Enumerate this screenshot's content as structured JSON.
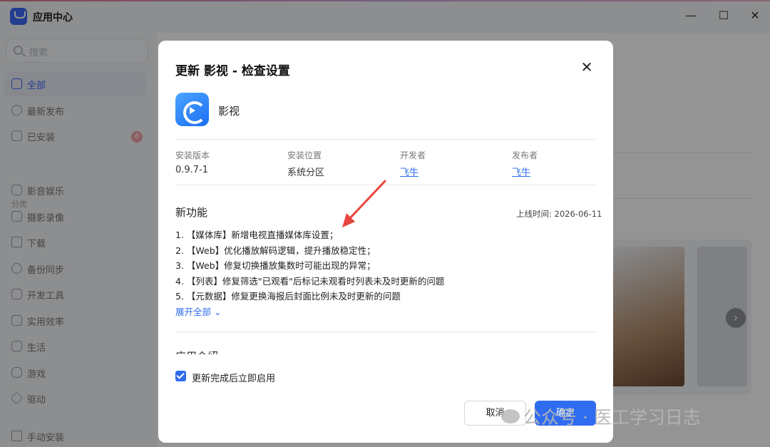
{
  "window": {
    "title": "应用中心",
    "minimize": "—",
    "maximize": "☐",
    "close": "✕"
  },
  "sidebar": {
    "search_placeholder": "搜索",
    "items": [
      {
        "label": "全部",
        "active": true
      },
      {
        "label": "最新发布"
      },
      {
        "label": "已安装",
        "badge": "6"
      }
    ],
    "category_title": "分类",
    "categories": [
      "影音娱乐",
      "摄影录像",
      "下载",
      "备份同步",
      "开发工具",
      "实用效率",
      "生活",
      "游戏",
      "驱动"
    ],
    "manual_install": "手动安装"
  },
  "background": {
    "carousel_next": "›"
  },
  "modal": {
    "title": "更新 影视 - 检查设置",
    "close": "✕",
    "app_name": "影视",
    "info": [
      {
        "label": "安装版本",
        "value": "0.9.7-1"
      },
      {
        "label": "安装位置",
        "value": "系统分区"
      },
      {
        "label": "开发者",
        "value": "飞牛"
      },
      {
        "label": "发布者",
        "value": "飞牛"
      }
    ],
    "new_features_title": "新功能",
    "release_date": "上线时间: 2026-06-11",
    "features": [
      "1. 【媒体库】新增电视直播媒体库设置；",
      "2. 【Web】优化播放解码逻辑，提升播放稳定性；",
      "3. 【Web】修复切换播放集数时可能出现的异常；",
      "4. 【列表】修复筛选\"已观看\"后标记未观看时列表未及时更新的问题",
      "5. 【元数据】修复更换海报后封面比例未及时更新的问题"
    ],
    "expand_all": "展开全部",
    "intro_title": "应用介绍",
    "checkbox_label": "更新完成后立即启用",
    "cancel": "取消",
    "confirm": "确定"
  },
  "watermark": "公众号 · 医工学习日志"
}
